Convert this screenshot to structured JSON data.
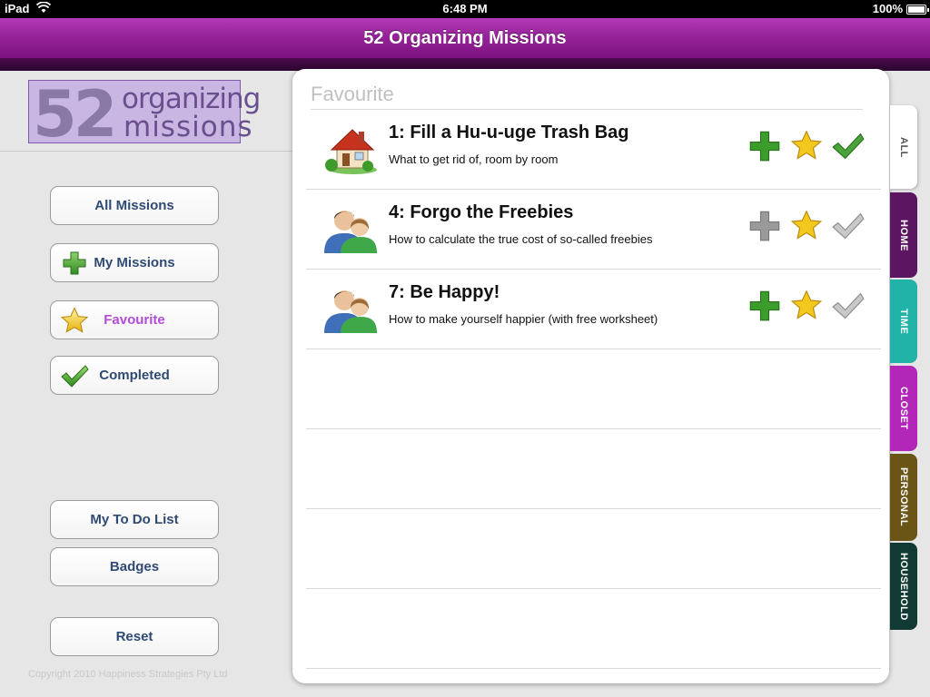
{
  "status": {
    "device": "iPad",
    "time": "6:48 PM",
    "battery": "100%",
    "battery_level": 1.0
  },
  "app": {
    "title": "52 Organizing Missions"
  },
  "logo": {
    "number": "52",
    "line1": "organizing",
    "line2": "missions"
  },
  "sidebar": {
    "all_missions": "All Missions",
    "my_missions": "My Missions",
    "favourite": "Favourite",
    "completed": "Completed",
    "todo": "My To Do List",
    "badges": "Badges",
    "reset": "Reset",
    "copyright": "Copyright 2010 Happiness Strategies Pty Ltd"
  },
  "main": {
    "heading": "Favourite",
    "missions": [
      {
        "title": "1: Fill a Hu-u-uge Trash Bag",
        "subtitle": "What to get rid of, room by room",
        "icon": "house-icon",
        "added": true,
        "favourite": true,
        "completed": true
      },
      {
        "title": "4: Forgo the Freebies",
        "subtitle": "How to calculate the true cost of so-called freebies",
        "icon": "people-icon",
        "added": false,
        "favourite": true,
        "completed": false
      },
      {
        "title": "7: Be Happy!",
        "subtitle": "How to make yourself happier (with free worksheet)",
        "icon": "people-icon",
        "added": true,
        "favourite": true,
        "completed": false
      }
    ]
  },
  "tabs": [
    {
      "label": "ALL",
      "color": "#ffffff"
    },
    {
      "label": "HOME",
      "color": "#5c1560"
    },
    {
      "label": "TIME",
      "color": "#21b3a8"
    },
    {
      "label": "CLOSET",
      "color": "#b226b8"
    },
    {
      "label": "PERSONAL",
      "color": "#6a5516"
    },
    {
      "label": "HOUSEHOLD",
      "color": "#103a33"
    }
  ],
  "colors": {
    "accent": "#962399",
    "active_nav": "#b44bd6",
    "add_green": "#3a9d2c",
    "star_yellow": "#f2c81e",
    "check_green": "#4aa33a",
    "inactive_gray": "#9a9a9a"
  }
}
